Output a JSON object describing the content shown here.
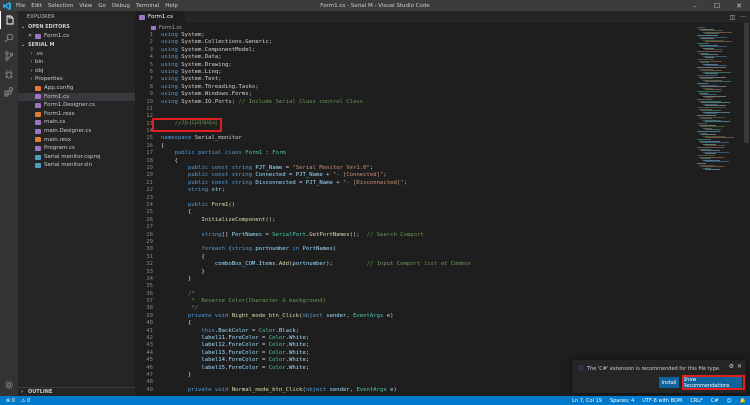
{
  "window": {
    "title": "Form1.cs - Serial M - Visual Studio Code",
    "menu": [
      "File",
      "Edit",
      "Selection",
      "View",
      "Go",
      "Debug",
      "Terminal",
      "Help"
    ],
    "controls": [
      "minimize",
      "maximize",
      "close"
    ]
  },
  "sidebar": {
    "title": "EXPLORER",
    "open_editors_label": "OPEN EDITORS",
    "open_editor_file": "Form1.cs",
    "project_label": "SERIAL M",
    "outline_label": "OUTLINE",
    "items": [
      {
        "label": ".vs",
        "type": "folder",
        "color": ""
      },
      {
        "label": "bin",
        "type": "folder",
        "color": ""
      },
      {
        "label": "obj",
        "type": "folder",
        "color": ""
      },
      {
        "label": "Properties",
        "type": "folder",
        "color": ""
      },
      {
        "label": "App.config",
        "type": "file",
        "color": "#e37933"
      },
      {
        "label": "Form1.cs",
        "type": "file",
        "color": "#a074c4"
      },
      {
        "label": "Form1.Designer.cs",
        "type": "file",
        "color": "#a074c4"
      },
      {
        "label": "Form1.resx",
        "type": "file",
        "color": "#e37933"
      },
      {
        "label": "main.cs",
        "type": "file",
        "color": "#a074c4"
      },
      {
        "label": "main.Designer.cs",
        "type": "file",
        "color": "#a074c4"
      },
      {
        "label": "main.resx",
        "type": "file",
        "color": "#e37933"
      },
      {
        "label": "Program.cs",
        "type": "file",
        "color": "#a074c4"
      },
      {
        "label": "Serial monitor.csproj",
        "type": "file",
        "color": "#519aba"
      },
      {
        "label": "Serial monitor.sln",
        "type": "file",
        "color": "#519aba"
      }
    ]
  },
  "editor": {
    "tab_label": "Form1.cs",
    "breadcrumb": "Form1.cs",
    "highlighted_comment": "//가나다라마바사"
  },
  "notification": {
    "message": "The 'C#' extension is recommended for this file type.",
    "install_label": "Install",
    "show_label": "Show Recommendations"
  },
  "statusbar": {
    "errors": "0",
    "warnings": "0",
    "position": "Ln 7, Col 19",
    "spaces": "Spaces: 4",
    "encoding": "UTF-8 with BOM",
    "eol": "CRLF",
    "language": "C#"
  },
  "colors": {
    "accent": "#007acc",
    "annotation": "#e02020",
    "button": "#0e639c"
  }
}
